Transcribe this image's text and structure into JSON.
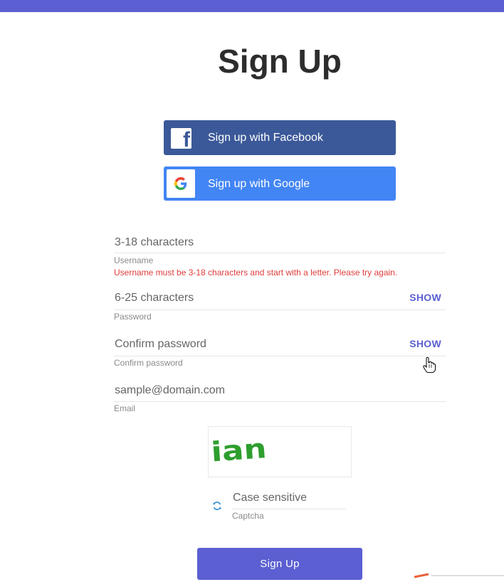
{
  "page": {
    "title": "Sign Up"
  },
  "social": {
    "facebook_label": "Sign up with Facebook",
    "google_label": "Sign up with Google"
  },
  "form": {
    "username": {
      "placeholder": "3-18 characters",
      "label": "Username",
      "error": "Username must be 3-18 characters and start with a letter. Please try again."
    },
    "password": {
      "placeholder": "6-25 characters",
      "label": "Password",
      "toggle": "SHOW"
    },
    "confirm": {
      "placeholder": "Confirm password",
      "label": "Confirm password",
      "toggle": "SHOW"
    },
    "email": {
      "placeholder": "sample@domain.com",
      "label": "Email"
    },
    "captcha": {
      "image_text": "ian",
      "placeholder": "Case sensitive",
      "label": "Captcha"
    },
    "submit_label": "Sign Up"
  },
  "colors": {
    "accent": "#5b5fd1",
    "facebook": "#3b5999",
    "google": "#4285f4",
    "error": "#e03b3b",
    "captcha_green": "#2e9e2e"
  },
  "icons": {
    "facebook": "facebook-icon",
    "google": "google-icon",
    "refresh": "refresh-icon",
    "cursor": "hand-cursor-icon"
  }
}
